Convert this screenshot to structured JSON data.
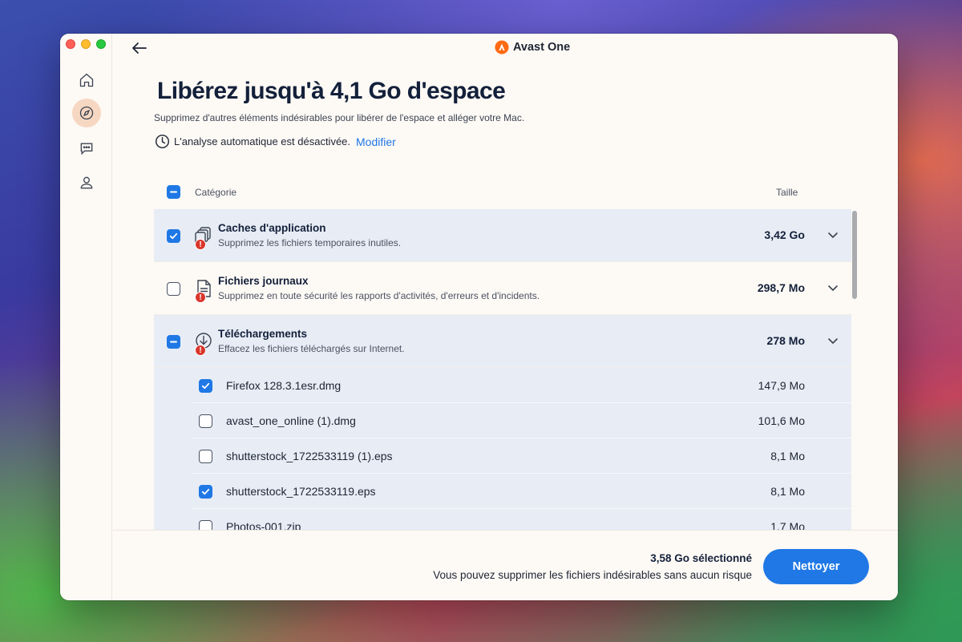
{
  "app": {
    "name": "Avast One"
  },
  "header": {
    "title_prefix": "Libérez jusqu'à ",
    "title_highlight": "4,1 Go d'espace",
    "subtitle": "Supprimez d'autres éléments indésirables pour libérer de l'espace et alléger votre Mac.",
    "autoscan_text": "L'analyse automatique est désactivée.",
    "autoscan_link": "Modifier"
  },
  "sidebar": {
    "items": [
      {
        "icon": "home-icon",
        "active": false
      },
      {
        "icon": "compass-icon",
        "active": true
      },
      {
        "icon": "chat-bubble-icon",
        "active": false
      },
      {
        "icon": "user-icon",
        "active": false
      }
    ]
  },
  "list": {
    "col_category": "Catégorie",
    "col_size": "Taille",
    "categories": [
      {
        "name": "Caches d'application",
        "desc": "Supprimez les fichiers temporaires inutiles.",
        "size": "3,42 Go",
        "state": "checked",
        "icon": "cache-stack-icon"
      },
      {
        "name": "Fichiers journaux",
        "desc": "Supprimez en toute sécurité les rapports d'activités, d'erreurs et d'incidents.",
        "size": "298,7 Mo",
        "state": "unchecked",
        "icon": "log-file-icon"
      },
      {
        "name": "Téléchargements",
        "desc": "Effacez les fichiers téléchargés sur Internet.",
        "size": "278 Mo",
        "state": "partial",
        "icon": "download-icon"
      }
    ],
    "files": [
      {
        "name": "Firefox 128.3.1esr.dmg",
        "size": "147,9 Mo",
        "checked": true
      },
      {
        "name": "avast_one_online (1).dmg",
        "size": "101,6 Mo",
        "checked": false
      },
      {
        "name": "shutterstock_1722533119 (1).eps",
        "size": "8,1 Mo",
        "checked": false
      },
      {
        "name": "shutterstock_1722533119.eps",
        "size": "8,1 Mo",
        "checked": true
      },
      {
        "name": "Photos-001.zip",
        "size": "1,7 Mo",
        "checked": false
      }
    ]
  },
  "footer": {
    "selected": "3,58 Go sélectionné",
    "safe_text": "Vous pouvez supprimer les fichiers indésirables sans aucun risque",
    "clean_button": "Nettoyer"
  },
  "colors": {
    "accent": "#1f78e5",
    "highlight": "#f7a99a",
    "row_shade": "#e7ecf5",
    "warning": "#d9362b",
    "brand": "#ff6a13"
  }
}
